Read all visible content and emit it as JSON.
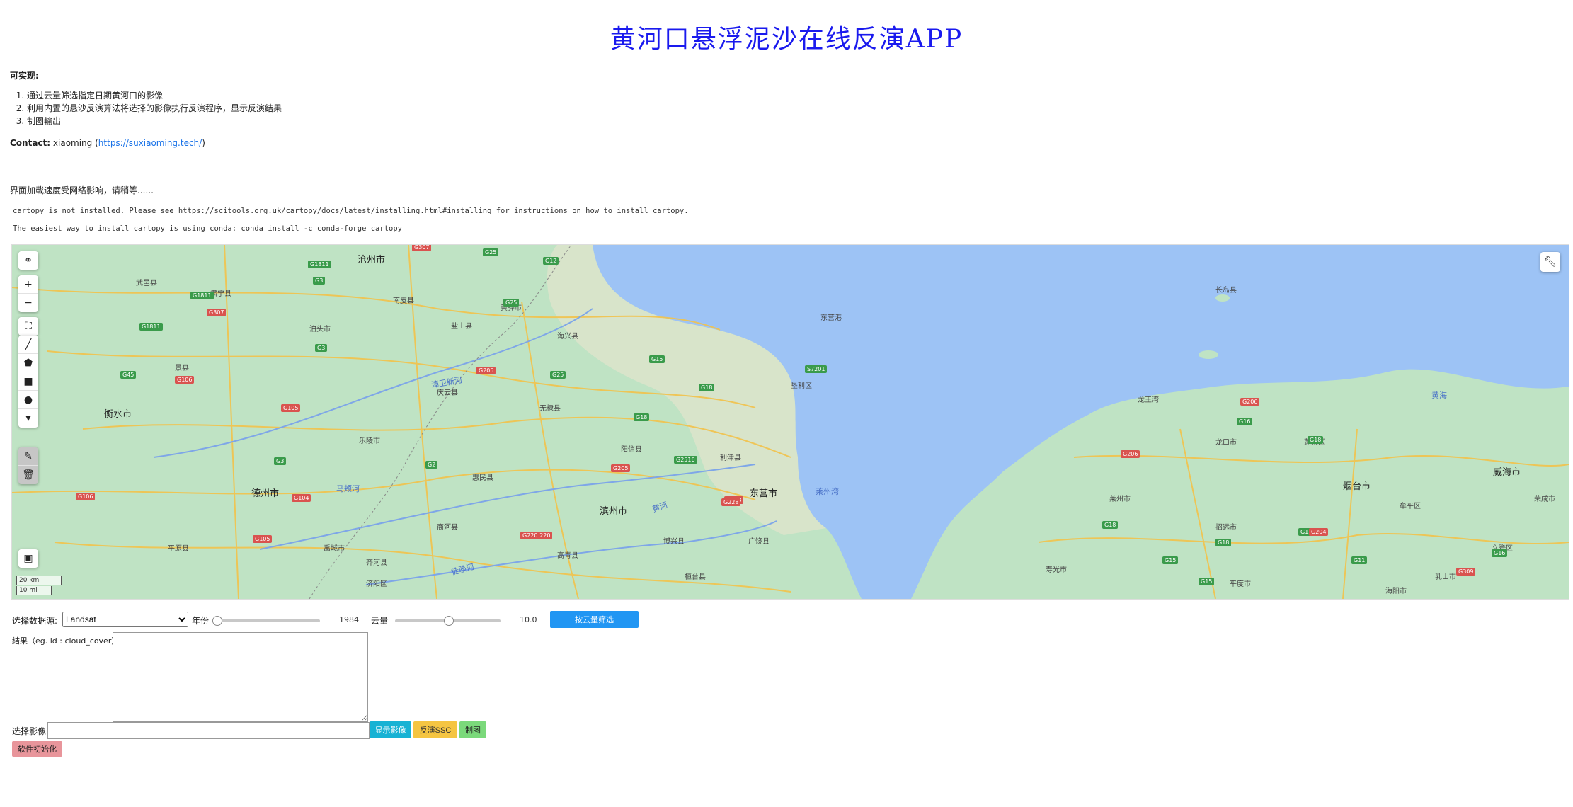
{
  "title": "黄河口悬浮泥沙在线反演APP",
  "intro": {
    "heading": "可实现:",
    "features": [
      "通过云量筛选指定日期黄河口的影像",
      "利用内置的悬沙反演算法将选择的影像执行反演程序，显示反演结果",
      "制图輸出"
    ],
    "contact_label": "Contact:",
    "contact_name": "xiaoming",
    "contact_url": "https://suxiaoming.tech/"
  },
  "loading_notice": "界面加載速度受网络影响，请稍等......",
  "warnings": [
    "cartopy is not installed. Please see https://scitools.org.uk/cartopy/docs/latest/installing.html#installing for instructions on how to install cartopy.",
    "The easiest way to install cartopy is using conda: conda install -c conda-forge cartopy"
  ],
  "map": {
    "scale_km": "20 km",
    "scale_mi": "10 mi",
    "cities": [
      {
        "name": "沧州市"
      },
      {
        "name": "衡水市"
      },
      {
        "name": "德州市"
      },
      {
        "name": "滨州市"
      },
      {
        "name": "东营市"
      },
      {
        "name": "烟台市"
      },
      {
        "name": "威海市"
      }
    ],
    "waters": [
      {
        "name": "漳卫新河"
      },
      {
        "name": "马颊河"
      },
      {
        "name": "徒骇河"
      },
      {
        "name": "黄河"
      },
      {
        "name": "莱州湾"
      },
      {
        "name": "黄海"
      },
      {
        "name": "东营港"
      },
      {
        "name": "龙王湾"
      }
    ],
    "places": [
      {
        "name": "肃宁县"
      },
      {
        "name": "泊头市"
      },
      {
        "name": "南皮县"
      },
      {
        "name": "盐山县"
      },
      {
        "name": "黄骅市"
      },
      {
        "name": "海兴县"
      },
      {
        "name": "庆云县"
      },
      {
        "name": "无棣县"
      },
      {
        "name": "乐陵市"
      },
      {
        "name": "阳信县"
      },
      {
        "name": "惠民县"
      },
      {
        "name": "利津县"
      },
      {
        "name": "垦利区"
      },
      {
        "name": "广饶县"
      },
      {
        "name": "寿光市"
      },
      {
        "name": "龙口市"
      },
      {
        "name": "蓬莱区"
      },
      {
        "name": "莱州市"
      },
      {
        "name": "招远市"
      },
      {
        "name": "平度市"
      },
      {
        "name": "长岛县"
      },
      {
        "name": "武邑县"
      },
      {
        "name": "景县"
      },
      {
        "name": "平原县"
      },
      {
        "name": "禹城市"
      },
      {
        "name": "齐河县"
      },
      {
        "name": "商河县"
      },
      {
        "name": "济阳区"
      },
      {
        "name": "桓台县"
      },
      {
        "name": "高青县"
      },
      {
        "name": "博兴县"
      },
      {
        "name": "牟平区"
      },
      {
        "name": "文登区"
      },
      {
        "name": "荣成市"
      },
      {
        "name": "乳山市"
      },
      {
        "name": "海阳市"
      }
    ],
    "shields_green": [
      "G1811",
      "G3",
      "G25",
      "G12",
      "G45",
      "G2",
      "G18",
      "G15",
      "G2516",
      "G1811",
      "G3",
      "G25",
      "G18",
      "G15",
      "G16",
      "G18",
      "G11",
      "G15",
      "G16",
      "S7201",
      "G18",
      "G1811",
      "G18",
      "G25",
      "G3",
      "G15"
    ],
    "shields_red": [
      "G307",
      "G105",
      "G106",
      "G104",
      "G205",
      "G220",
      "G228",
      "G206",
      "G309",
      "G204",
      "G307",
      "G105",
      "G205",
      "G220",
      "G206",
      "G228",
      "G106"
    ],
    "tools": [
      "globe-icon",
      "zoom-in-icon",
      "zoom-out-icon",
      "fullscreen-icon",
      "draw-line-icon",
      "draw-polygon-icon",
      "draw-rectangle-icon",
      "draw-circle-icon",
      "marker-icon",
      "edit-icon",
      "trash-icon"
    ]
  },
  "controls": {
    "datasource_label": "选择数据源:",
    "datasource_value": "Landsat",
    "year_label": "年份",
    "year_value": "1984",
    "year_fraction": 0.0,
    "cloud_label": "云量",
    "cloud_value": "10.0",
    "cloud_fraction": 0.5,
    "filter_button": "按云量筛选",
    "result_label": "結果（eg. id : cloud_cover）",
    "image_label": "选择影像",
    "show_button": "显示影像",
    "invert_button": "反演SSC",
    "map_button": "制图",
    "reset_button": "软件初始化"
  },
  "colors": {
    "title": "#1a1aee",
    "land": "#bfe3c4",
    "sea": "#9dc3f5",
    "filter_button": "#2196f3",
    "show_button": "#17b2d4",
    "invert_button": "#f5c542",
    "map_button": "#7bd97b",
    "reset_button": "#e8959b"
  }
}
